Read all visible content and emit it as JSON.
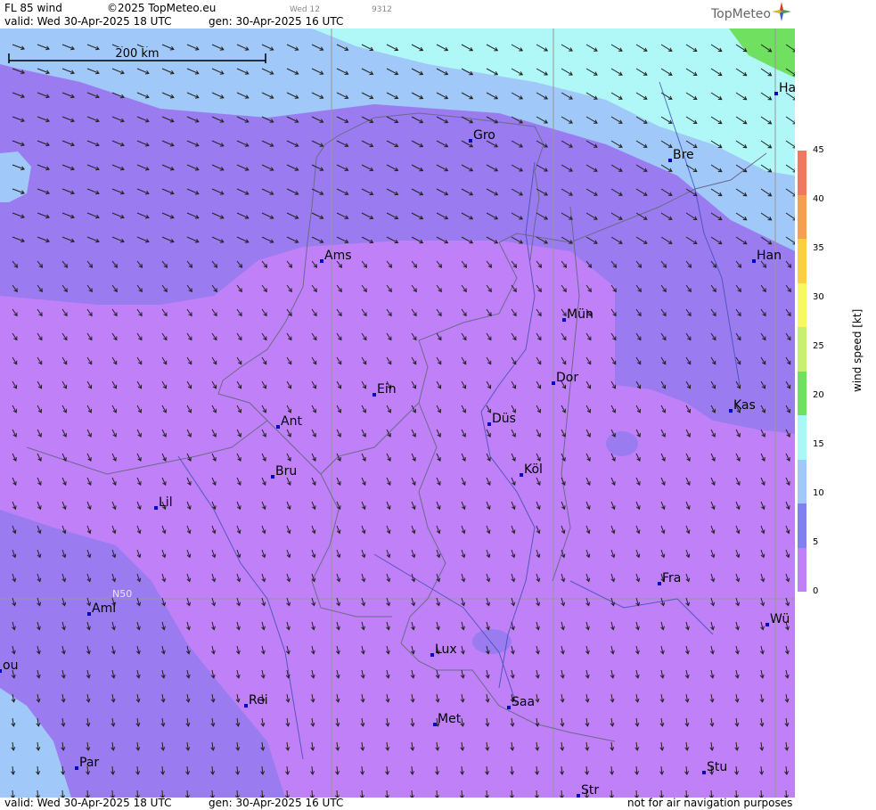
{
  "header": {
    "product": "FL 85 wind",
    "copyright": "©2025 TopMeteo.eu",
    "valid": "valid:  Wed  30-Apr-2025  18 UTC",
    "gen": "gen: 30-Apr-2025 16 UTC",
    "small_day": "Wed 12",
    "small_code": "9312"
  },
  "logo": {
    "text": "TopMeteo",
    "icon": "compass-star-icon"
  },
  "footer": {
    "valid": "valid:  Wed  30-Apr-2025  18 UTC",
    "gen": "gen: 30-Apr-2025 16 UTC",
    "disclaimer": "not for air navigation purposes"
  },
  "map": {
    "scale_label": "200 km",
    "lat_label": "N50",
    "cities": [
      {
        "name": "Gro"
      },
      {
        "name": "Bre"
      },
      {
        "name": "Ha"
      },
      {
        "name": "Ams"
      },
      {
        "name": "Han"
      },
      {
        "name": "Mün"
      },
      {
        "name": "Dor"
      },
      {
        "name": "Ein"
      },
      {
        "name": "Ant"
      },
      {
        "name": "Düs"
      },
      {
        "name": "Kas"
      },
      {
        "name": "Bru"
      },
      {
        "name": "Köl"
      },
      {
        "name": "Lil"
      },
      {
        "name": "Fra"
      },
      {
        "name": "Ami"
      },
      {
        "name": "Wü"
      },
      {
        "name": "Lux"
      },
      {
        "name": "ou"
      },
      {
        "name": "Rei"
      },
      {
        "name": "Saa"
      },
      {
        "name": "Met"
      },
      {
        "name": "Par"
      },
      {
        "name": "Stu"
      },
      {
        "name": "Str"
      }
    ]
  },
  "colorbar": {
    "title": "wind  speed  [kt]",
    "ticks": [
      "45",
      "40",
      "35",
      "30",
      "25",
      "20",
      "15",
      "10",
      "5",
      "0"
    ],
    "colors": [
      "#f07860",
      "#f5a050",
      "#fbd040",
      "#f8f860",
      "#c8f070",
      "#70e060",
      "#a8f8f8",
      "#a0c8f8",
      "#8080f0",
      "#c080f8"
    ]
  },
  "colors": {
    "level_0_5": "#c080f8",
    "level_5_10": "#9a7cf0",
    "level_10_15": "#a0c8f8",
    "level_15_20": "#b0f8f8",
    "level_20_25": "#70e060"
  }
}
